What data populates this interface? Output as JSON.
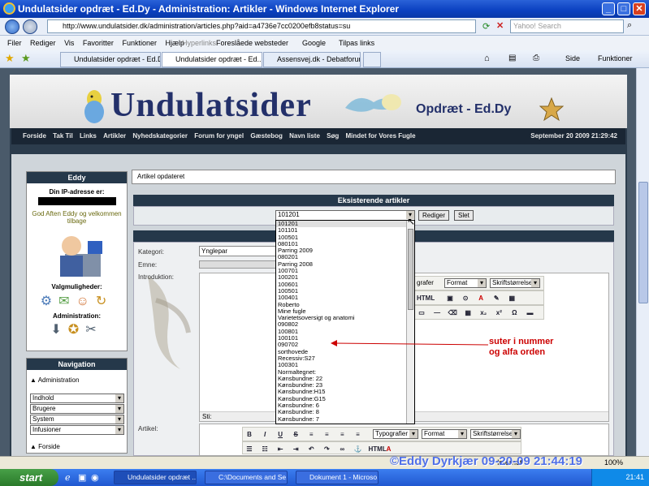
{
  "window": {
    "title": "Undulatsider opdræt - Ed.Dy - Administration: Artikler - Windows Internet Explorer",
    "minimize": "_",
    "maximize": "□",
    "close": "✕"
  },
  "address": {
    "url": "http://www.undulatsider.dk/administration/articles.php?aid=a4736e7cc0200efb8status=su",
    "search_placeholder": "Yahoo! Search"
  },
  "menu": [
    "Filer",
    "Rediger",
    "Vis",
    "Favoritter",
    "Funktioner",
    "Hjælp"
  ],
  "links_bar": {
    "label": "Hyperlinks",
    "items": [
      "Foreslåede websteder",
      "Google",
      "Tilpas links"
    ]
  },
  "tabs": [
    {
      "label": "Undulatsider opdræt - Ed.Dy..."
    },
    {
      "label": "Undulatsider opdræt - Ed..."
    },
    {
      "label": "Assensvej.dk - Debatforum: ..."
    }
  ],
  "ie_tools": {
    "page": "Side",
    "tools": "Funktioner"
  },
  "site": {
    "logo": "Undulatsider",
    "tagline": "Opdræt - Ed.Dy",
    "nav": [
      "Forside",
      "Tak Til",
      "Links",
      "Artikler",
      "Nyhedskategorier",
      "Forum for yngel",
      "Gæstebog",
      "Navn liste",
      "Søg",
      "Mindet for Vores Fugle"
    ],
    "date": "September 20 2009 21:29:42"
  },
  "user_panel": {
    "title": "Eddy",
    "ip_label": "Din IP-adresse er:",
    "greeting": "God Aften Eddy og velkommen tilbage",
    "options_title": "Valgmuligheder:",
    "admin_title": "Administration:"
  },
  "navigation": {
    "title": "Navigation",
    "admin_label": "Administration",
    "selects": [
      "Indhold",
      "Brugere",
      "System",
      "Infusioner"
    ],
    "forside": "Forside"
  },
  "main": {
    "status": "Artikel opdateret",
    "existing_title": "Eksisterende artikler",
    "selected_article": "101201",
    "edit_button": "Rediger",
    "delete_button": "Slet",
    "kategori_label": "Kategori:",
    "kategori_value": "Ynglepar",
    "emne_label": "Emne:",
    "intro_label": "Introduktion:",
    "artikel_label": "Artikel:",
    "sti_label": "Sti:",
    "editor": {
      "font_tail": "grafer",
      "font": "Typografier",
      "format": "Format",
      "size": "Skriftstørrelse",
      "html_btn": "HTML"
    }
  },
  "dropdown_items": [
    "101201",
    "101101",
    "100501",
    "080101",
    "Parring 2009",
    "080201",
    "Parring 2008",
    "100701",
    "100201",
    "100601",
    "100501",
    "100401",
    "Roberto",
    "Mine fugle",
    "Varietetsoversigt og anatomi",
    "090802",
    "100801",
    "100101",
    "090702",
    "sorthovede",
    "Recessiv:S27",
    "100301",
    "Normaltegnet:",
    "Kønsbundne: 22",
    "Kønsbundne: 23",
    "Kønsbundne:H15",
    "Kønsbundne:G15",
    "Kønsbundne: 6",
    "Kønsbundne: 8",
    "Kønsbundne: 7"
  ],
  "annotation": {
    "line1": "suter i nummer",
    "line2": "og alfa orden"
  },
  "status_bar": {
    "text": "Internet",
    "zoom": "100%"
  },
  "watermark": "©Eddy Dyrkjær 09-20-09 21:44:19",
  "taskbar": {
    "start": "start",
    "tasks": [
      "Undulatsider opdræt ...",
      "C:\\Documents and Se...",
      "Dokument 1 - Microso..."
    ],
    "clock": "21:41"
  }
}
